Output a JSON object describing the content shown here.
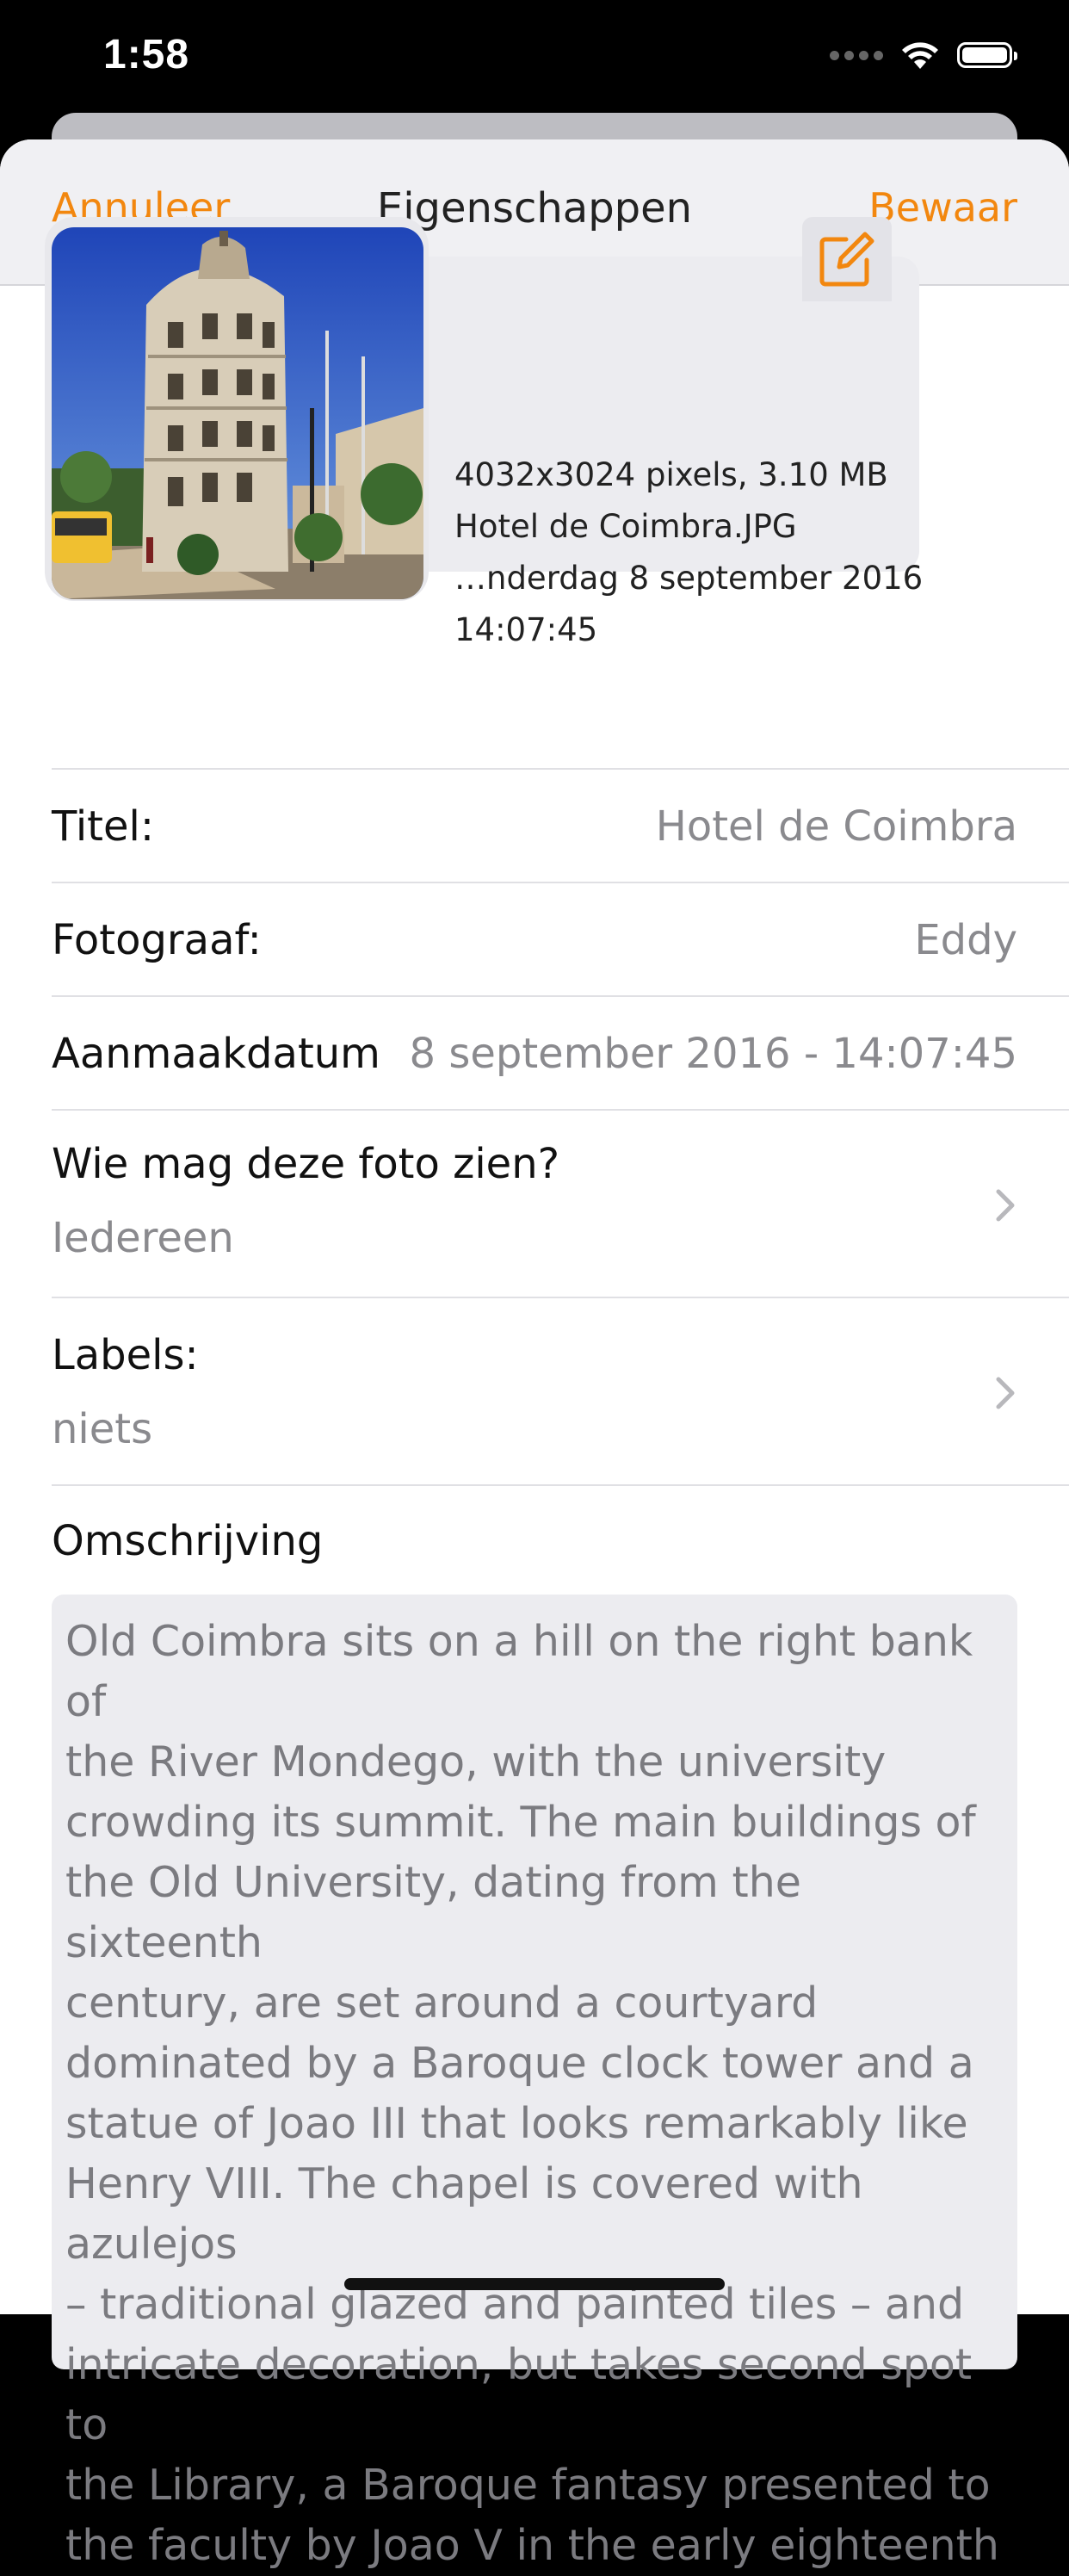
{
  "status_bar": {
    "time": "1:58",
    "icons": [
      "signal-dots-icon",
      "wifi-icon",
      "battery-icon"
    ]
  },
  "nav": {
    "cancel_label": "Annuleer",
    "title": "Eigenschappen",
    "save_label": "Bewaar"
  },
  "photo_info": {
    "dimensions_size": "4032x3024 pixels, 3.10 MB",
    "filename": "Hotel de Coimbra.JPG",
    "date_line": "…nderdag 8 september 2016",
    "time_line": "14:07:45",
    "edit_icon": "edit-square-pencil-icon"
  },
  "fields": {
    "title_label": "Titel:",
    "title_value": "Hotel de Coimbra",
    "photographer_label": "Fotograaf:",
    "photographer_value": "Eddy",
    "created_label": "Aanmaakdatum",
    "created_value": "8 september 2016 - 14:07:45",
    "visibility_label": "Wie mag deze foto zien?",
    "visibility_value": "Iedereen",
    "labels_label": "Labels:",
    "labels_value": "niets"
  },
  "description": {
    "label": "Omschrijving",
    "lines": [
      "Old Coimbra sits on a hill on the right bank of",
      "the River Mondego, with the university",
      "crowding its summit. The main buildings of",
      "the Old University, dating from the sixteenth",
      "century, are set around a courtyard",
      "dominated by a Baroque clock tower and a",
      "statue of Joao III that looks remarkably like",
      "Henry VIII. The chapel is covered with azulejos",
      "– traditional glazed and painted tiles – and",
      "intricate decoration, but takes second spot to",
      "the Library, a Baroque fantasy presented to",
      "the faculty by Joao V in the early eighteenth"
    ]
  },
  "colors": {
    "accent": "#f2870f",
    "secondary_text": "#8a8a8e"
  }
}
